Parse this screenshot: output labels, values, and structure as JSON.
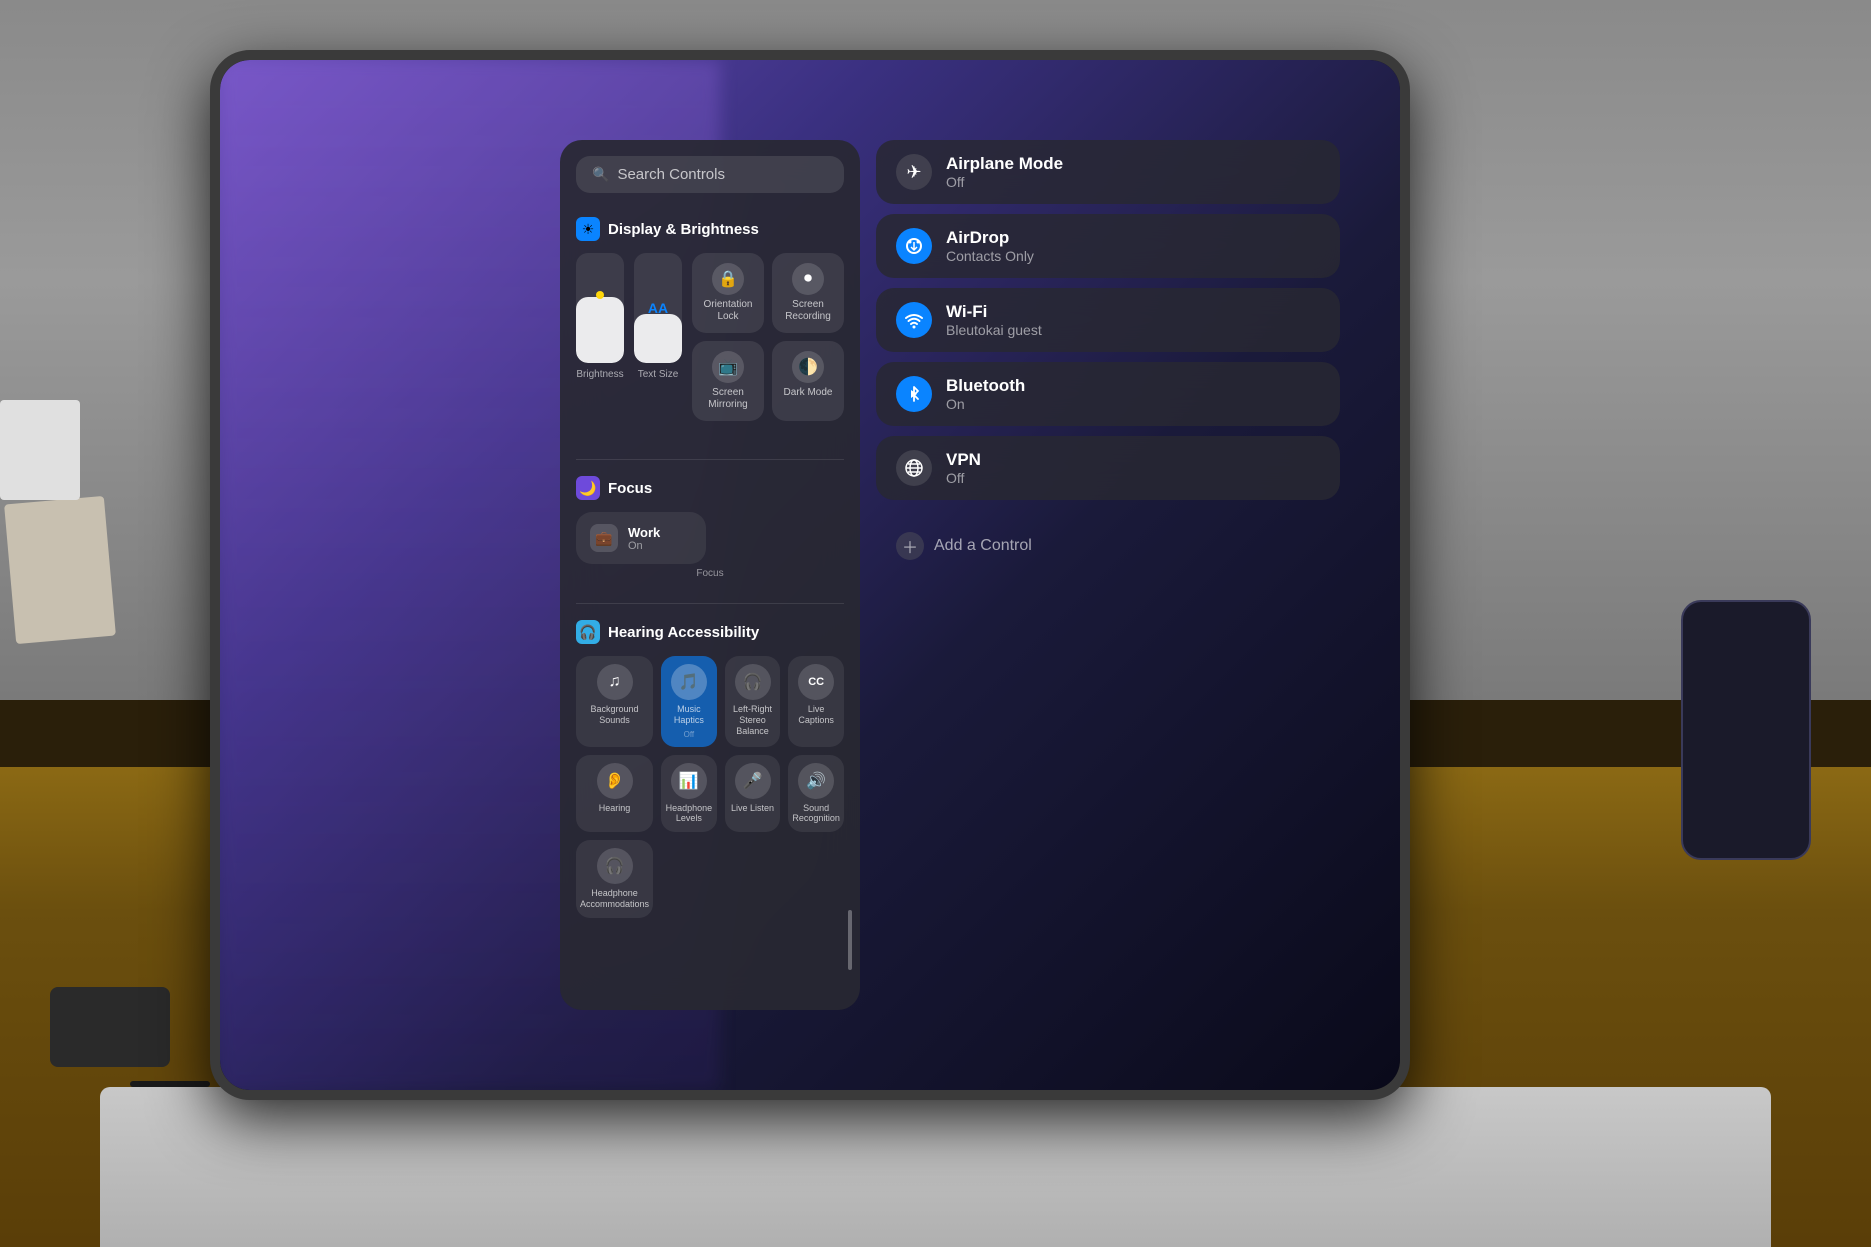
{
  "environment": {
    "wall_color": "#8a8a8a",
    "table_color": "#6B4F0E"
  },
  "ipad": {
    "screen_bg": "#1a1a2a"
  },
  "control_center": {
    "search": {
      "placeholder": "Search Controls",
      "icon": "search"
    },
    "sections": {
      "display": {
        "title": "Display & Brightness",
        "icon": "☀️",
        "brightness_label": "Brightness",
        "text_size_label": "Text Size",
        "orientation_lock_label": "Orientation Lock",
        "screen_recording_label": "Screen Recording",
        "screen_mirroring_label": "Screen Mirroring",
        "dark_mode_label": "Dark Mode"
      },
      "focus": {
        "title": "Focus",
        "icon": "🌙",
        "work_title": "Work",
        "work_subtitle": "On",
        "work_label": "Focus"
      },
      "hearing": {
        "title": "Hearing Accessibility",
        "icon": "🔵",
        "items": [
          {
            "label": "Background Sounds",
            "sublabel": "",
            "active": false,
            "icon": "♫"
          },
          {
            "label": "Music Haptics",
            "sublabel": "Off",
            "active": true,
            "icon": "🎵"
          },
          {
            "label": "Left-Right Stereo Balance",
            "sublabel": "",
            "active": false,
            "icon": "🎧"
          },
          {
            "label": "Live Captions",
            "sublabel": "",
            "active": false,
            "icon": "CC"
          },
          {
            "label": "Hearing",
            "sublabel": "",
            "active": false,
            "icon": "👂"
          },
          {
            "label": "Headphone Levels",
            "sublabel": "",
            "active": false,
            "icon": "📊"
          },
          {
            "label": "Live Listen",
            "sublabel": "",
            "active": false,
            "icon": "🎤"
          },
          {
            "label": "Sound Recognition",
            "sublabel": "",
            "active": false,
            "icon": "🔊"
          },
          {
            "label": "Headphone Accommodations",
            "sublabel": "",
            "active": false,
            "icon": "🎧"
          }
        ]
      }
    },
    "right_panel": {
      "items": [
        {
          "id": "airplane",
          "title": "Airplane Mode",
          "subtitle": "Off",
          "icon": "✈",
          "icon_style": "dark"
        },
        {
          "id": "airdrop",
          "title": "AirDrop",
          "subtitle": "Contacts Only",
          "icon": "📡",
          "icon_style": "blue"
        },
        {
          "id": "wifi",
          "title": "Wi-Fi",
          "subtitle": "Bleutokai guest",
          "icon": "📶",
          "icon_style": "blue"
        },
        {
          "id": "bluetooth",
          "title": "Bluetooth",
          "subtitle": "On",
          "icon": "🔵",
          "icon_style": "blue"
        },
        {
          "id": "vpn",
          "title": "VPN",
          "subtitle": "Off",
          "icon": "🌐",
          "icon_style": "dark"
        }
      ],
      "add_control_label": "Add a Control"
    }
  }
}
